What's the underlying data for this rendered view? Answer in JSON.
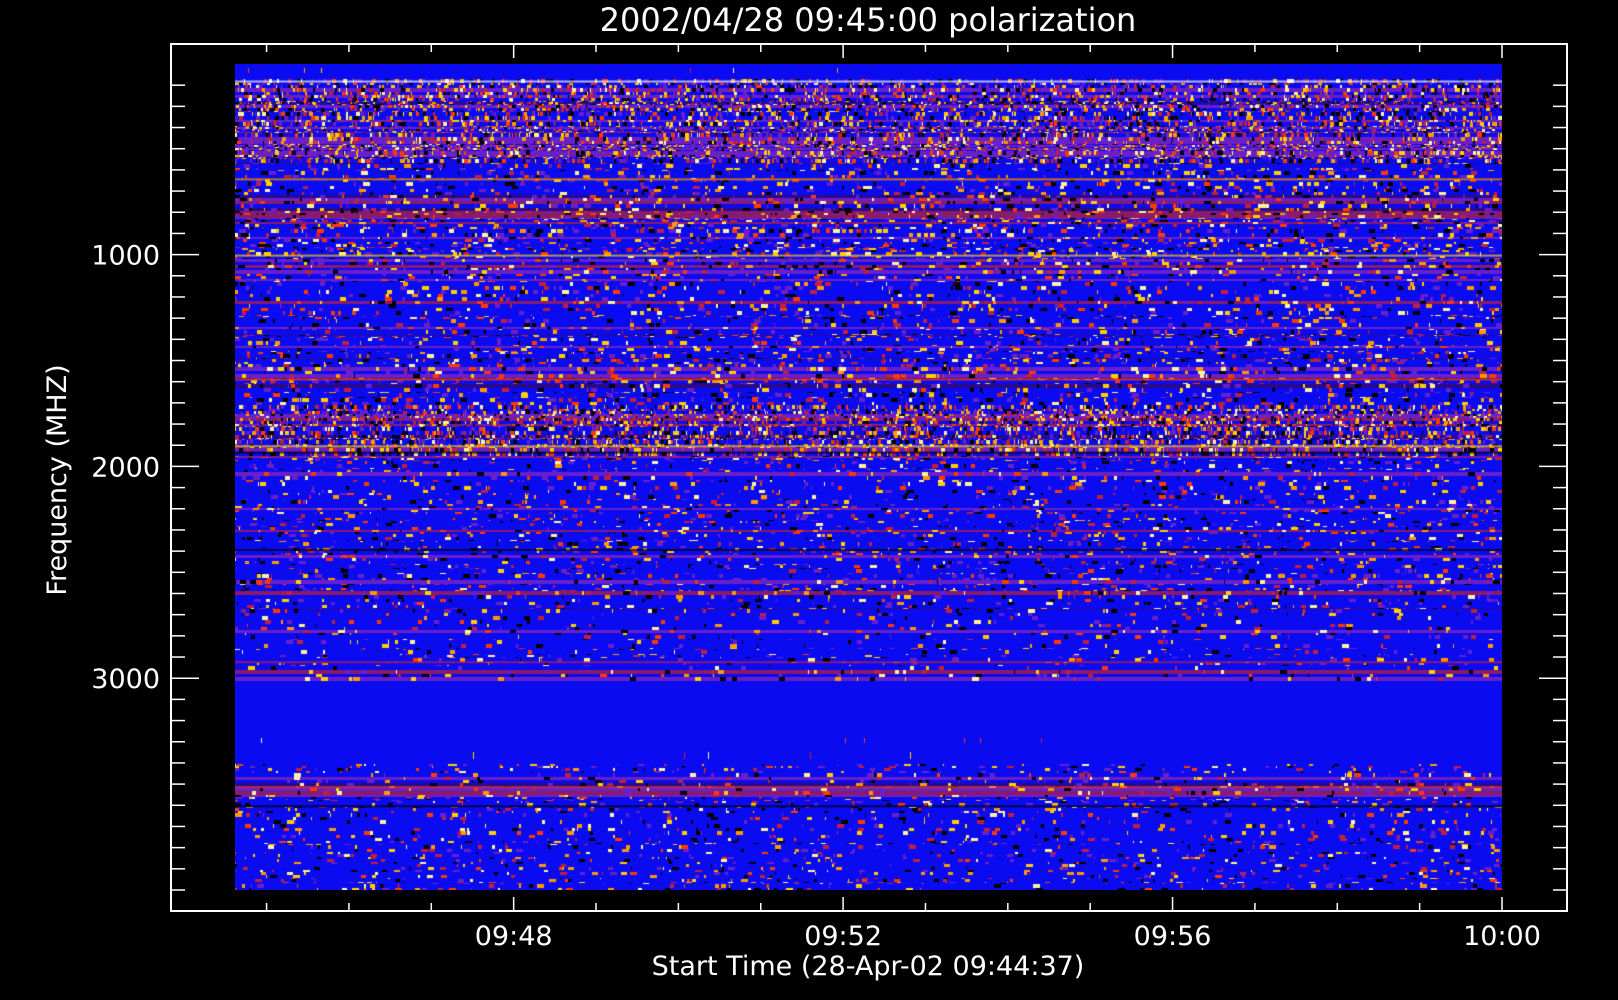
{
  "chart_data": {
    "type": "heatmap",
    "title": "2002/04/28 09:45:00 polarization",
    "xlabel": "Start Time (28-Apr-02 09:44:37)",
    "ylabel": "Frequency (MHZ)",
    "x_start": "09:44:37",
    "x_end": "10:00:00",
    "x_ticks": [
      "09:48",
      "09:52",
      "09:56",
      "10:00"
    ],
    "x_minor_ticks_per_major": 4,
    "y_ticks": [
      1000,
      2000,
      3000
    ],
    "y_range": [
      100,
      4000
    ],
    "y_inverted": true,
    "colorscale": [
      "#000000",
      "#1010f0",
      "#6a20c8",
      "#c02040",
      "#ff3a00",
      "#ff9a00",
      "#ffd000",
      "#fff2a0"
    ],
    "background": "#0b0bf2",
    "bands": [
      {
        "from": 100,
        "to": 170,
        "level": "low"
      },
      {
        "from": 170,
        "to": 560,
        "level": "high-speckle"
      },
      {
        "from": 560,
        "to": 700,
        "level": "medium"
      },
      {
        "from": 700,
        "to": 1000,
        "level": "medium-high"
      },
      {
        "from": 1000,
        "to": 1450,
        "level": "medium"
      },
      {
        "from": 1450,
        "to": 1700,
        "level": "medium-high"
      },
      {
        "from": 1700,
        "to": 1950,
        "level": "high (yellow bursts near 1900)"
      },
      {
        "from": 1950,
        "to": 2700,
        "level": "medium"
      },
      {
        "from": 2700,
        "to": 3000,
        "level": "medium-low"
      },
      {
        "from": 3000,
        "to": 3400,
        "level": "low"
      },
      {
        "from": 3400,
        "to": 4000,
        "level": "medium"
      }
    ]
  }
}
